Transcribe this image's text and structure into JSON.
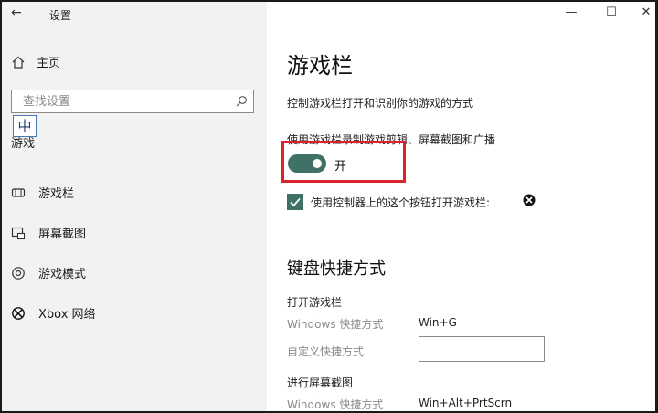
{
  "window": {
    "title": "设置",
    "back_glyph": "←",
    "controls": {
      "minimize": "—",
      "maximize": "☐",
      "close": "✕"
    }
  },
  "sidebar": {
    "home_label": "主页",
    "search": {
      "placeholder": "查找设置"
    },
    "ime_indicator": "中",
    "section_label": "游戏",
    "items": [
      {
        "label": "游戏栏",
        "icon": "game-bar-icon"
      },
      {
        "label": "屏幕截图",
        "icon": "screenshot-icon"
      },
      {
        "label": "游戏模式",
        "icon": "game-mode-icon"
      },
      {
        "label": "Xbox 网络",
        "icon": "xbox-icon"
      }
    ]
  },
  "main": {
    "title": "游戏栏",
    "description": "控制游戏栏打开和识别你的游戏的方式",
    "record_setting": {
      "label": "使用游戏栏录制游戏剪辑、屏幕截图和广播",
      "toggle_state": "开"
    },
    "controller_checkbox": {
      "label": "使用控制器上的这个按钮打开游戏栏:",
      "checked": true
    },
    "shortcuts": {
      "title": "键盘快捷方式",
      "open_game_bar": {
        "title": "打开游戏栏",
        "windows_label": "Windows 快捷方式",
        "windows_value": "Win+G",
        "custom_label": "自定义快捷方式",
        "custom_value": ""
      },
      "screenshot": {
        "title": "进行屏幕截图",
        "windows_label": "Windows 快捷方式",
        "windows_value": "Win+Alt+PrtScrn"
      }
    }
  },
  "colors": {
    "accent": "#3f7166",
    "highlight": "#d9242b",
    "sidebar_bg": "#f2f2f2"
  }
}
